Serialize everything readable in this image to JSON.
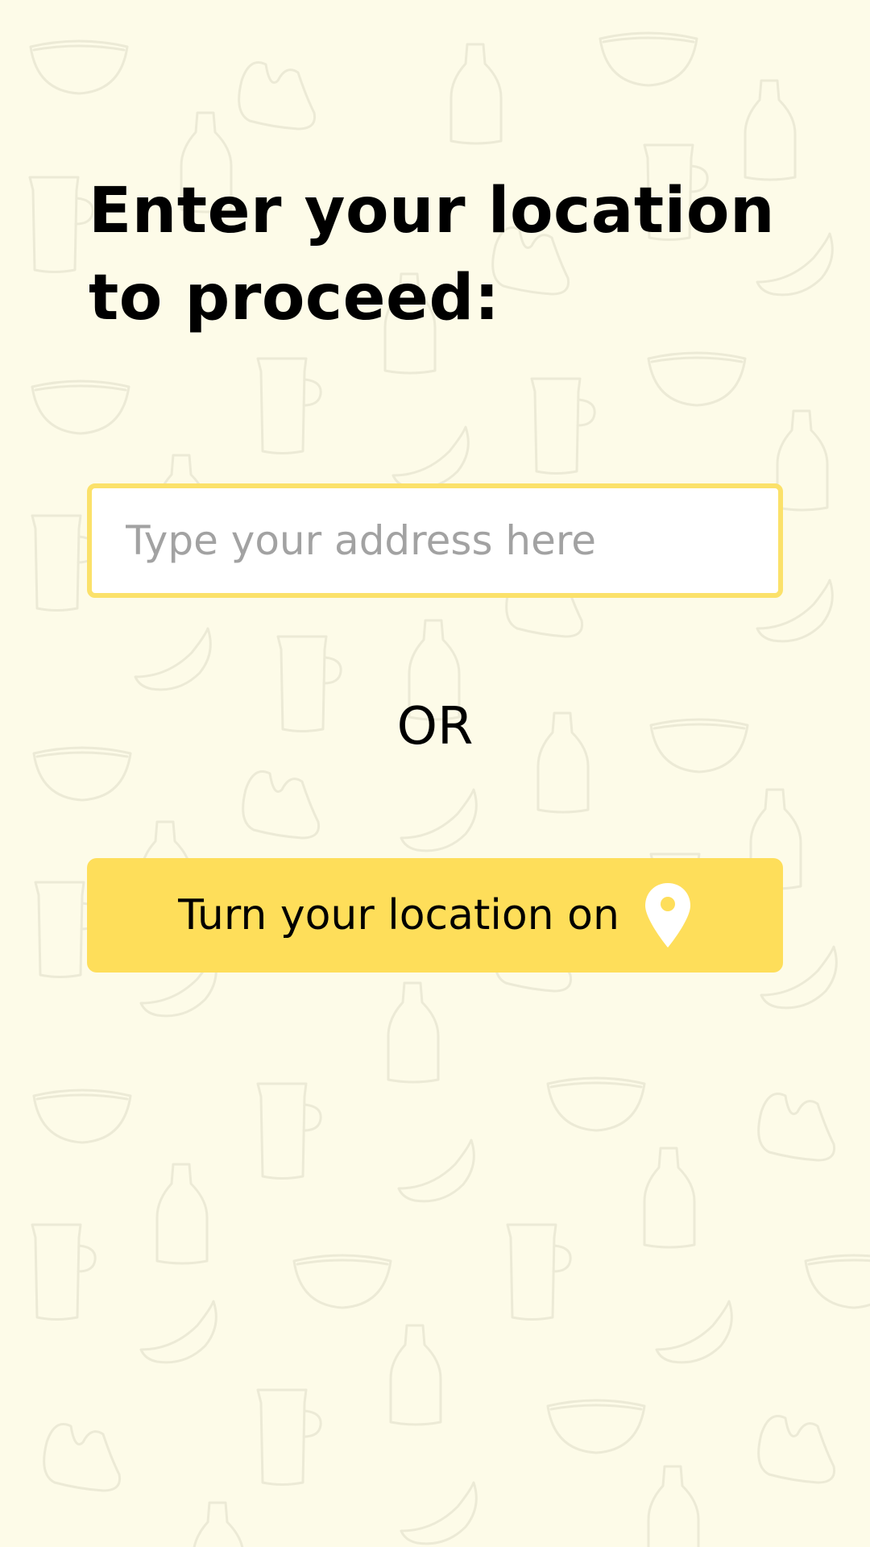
{
  "heading": "Enter your location to proceed:",
  "address": {
    "value": "",
    "placeholder": "Type your address here"
  },
  "divider_text": "OR",
  "location_button": {
    "label": "Turn your location on",
    "icon": "location-pin-icon"
  },
  "colors": {
    "background": "#fdfbe8",
    "accent": "#fede5a",
    "input_border": "#fbe16a",
    "pattern_stroke": "#ecead6"
  },
  "background_pattern": {
    "icons": [
      "bowl-icon",
      "bottle-icon",
      "jug-icon",
      "blob-icon",
      "slice-icon"
    ]
  }
}
